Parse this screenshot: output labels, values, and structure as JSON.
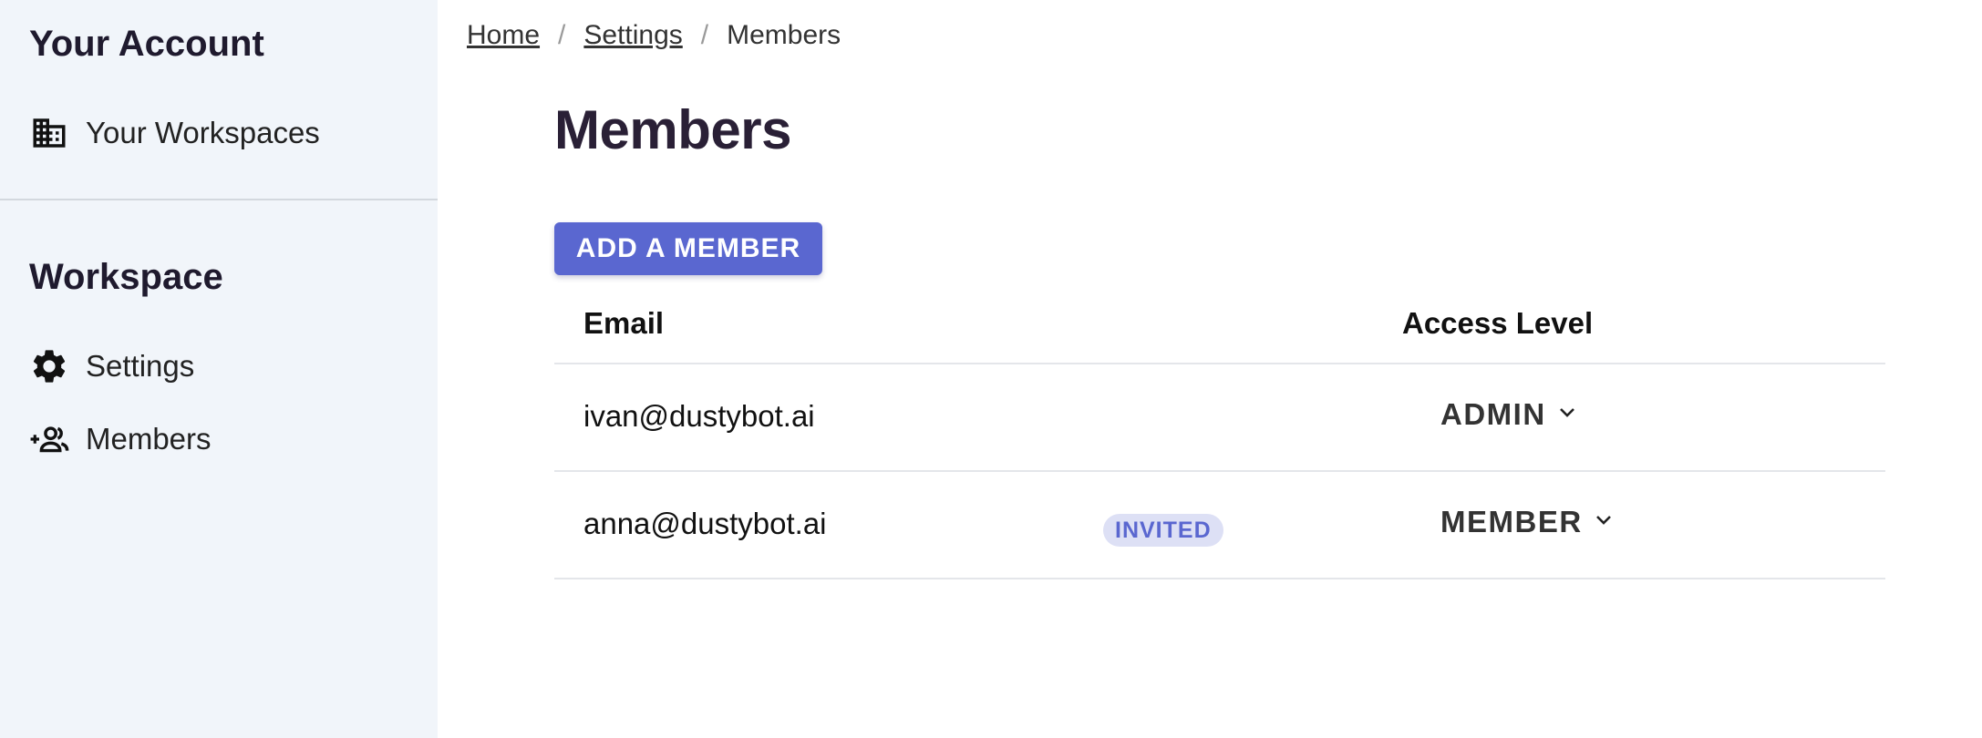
{
  "sidebar": {
    "account_heading": "Your Account",
    "workspaces_label": "Your Workspaces",
    "workspace_heading": "Workspace",
    "items": [
      {
        "label": "Settings",
        "icon": "gear-icon"
      },
      {
        "label": "Members",
        "icon": "add-user-icon"
      }
    ],
    "workspaces_icon": "building-icon"
  },
  "breadcrumb": {
    "home": "Home",
    "settings": "Settings",
    "current": "Members",
    "separator": "/"
  },
  "page": {
    "title": "Members",
    "add_button": "ADD A MEMBER"
  },
  "table": {
    "headers": {
      "email": "Email",
      "access": "Access Level"
    },
    "rows": [
      {
        "email": "ivan@dustybot.ai",
        "badge": "",
        "access": "ADMIN"
      },
      {
        "email": "anna@dustybot.ai",
        "badge": "INVITED",
        "access": "MEMBER"
      }
    ]
  },
  "colors": {
    "accent": "#5a67d0",
    "sidebar_bg": "#f1f5fa",
    "badge_bg": "#dde0f5"
  }
}
